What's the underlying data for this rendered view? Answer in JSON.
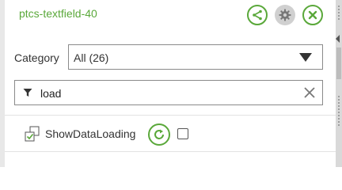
{
  "panel": {
    "title": "ptcs-textfield-40",
    "header_buttons": {
      "share_icon": "share-icon",
      "gear_icon": "gear-icon",
      "close_icon": "close-icon"
    }
  },
  "category": {
    "label": "Category",
    "selected": "All (26)"
  },
  "filter": {
    "value": "load",
    "icon": "filter-icon",
    "clear_icon": "clear-icon"
  },
  "properties": [
    {
      "label": "ShowDataLoading",
      "icon": "binding-icon",
      "checked": false
    }
  ],
  "colors": {
    "accent": "#5aa83a",
    "text": "#333333",
    "border": "#8a8a8a",
    "gear_bg": "#d0d0d0"
  }
}
